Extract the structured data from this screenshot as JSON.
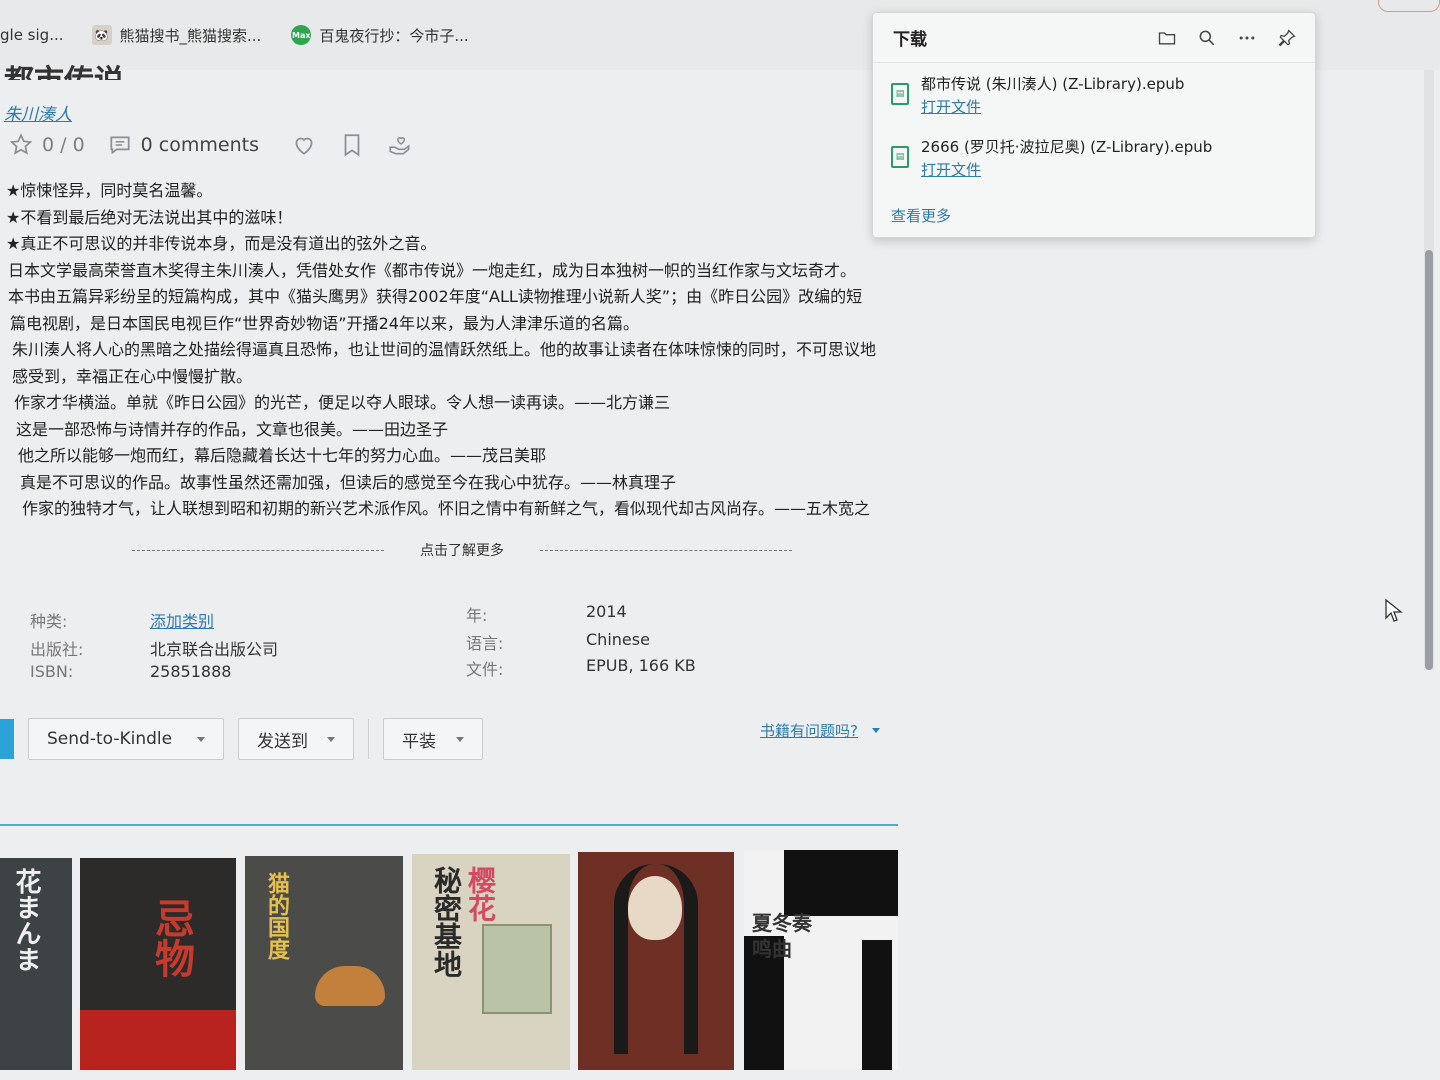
{
  "bookmarks": [
    {
      "label": "gle sig...",
      "icon": "none"
    },
    {
      "label": "熊猫搜书_熊猫搜索...",
      "icon": "panda-icon"
    },
    {
      "label": "百鬼夜行抄：今市子...",
      "icon": "max-icon",
      "badge": "Max"
    }
  ],
  "book": {
    "title": "都市传说",
    "author": "朱川湊人",
    "rating": "0 / 0",
    "comments": "0 comments"
  },
  "description": [
    "★惊悚怪异，同时莫名温馨。",
    "★不看到最后绝对无法说出其中的滋味！",
    "★真正不可思议的并非传说本身，而是没有道出的弦外之音。",
    "日本文学最高荣誉直木奖得主朱川湊人，凭借处女作《都市传说》一炮走红，成为日本独树一帜的当红作家与文坛奇才。",
    "本书由五篇异彩纷呈的短篇构成，其中《猫头鹰男》获得2002年度“ALL读物推理小说新人奖”；由《昨日公园》改编的短",
    "篇电视剧，是日本国民电视巨作“世界奇妙物语”开播24年以来，最为人津津乐道的名篇。",
    "朱川湊人将人心的黑暗之处描绘得逼真且恐怖，也让世间的温情跃然纸上。他的故事让读者在体味惊悚的同时，不可思议地",
    "感受到，幸福正在心中慢慢扩散。",
    "作家才华横溢。单就《昨日公园》的光芒，便足以夺人眼球。令人想一读再读。——北方谦三",
    "这是一部恐怖与诗情并存的作品，文章也很美。——田边圣子",
    "他之所以能够一炮而红，幕后隐藏着长达十七年的努力心血。——茂吕美耶",
    "真是不可思议的作品。故事性虽然还需加强，但读后的感觉至今在我心中犹存。——林真理子",
    "作家的独特才气，让人联想到昭和初期的新兴艺术派作风。怀旧之情中有新鲜之气，看似现代却古风尚存。——五木宽之"
  ],
  "more_link": "点击了解更多",
  "meta": {
    "category_label": "种类:",
    "category_value": "添加类别",
    "publisher_label": "出版社:",
    "publisher_value": "北京联合出版公司",
    "isbn_label": "ISBN:",
    "isbn_value": "25851888",
    "year_label": "年:",
    "year_value": "2014",
    "language_label": "语言:",
    "language_value": "Chinese",
    "file_label": "文件:",
    "file_value": "EPUB, 166 KB"
  },
  "buttons": {
    "kindle": "Send-to-Kindle",
    "send_to": "发送到",
    "format": "平装",
    "problem": "书籍有问题吗?"
  },
  "covers": [
    {
      "title": "花まんま",
      "bg": "#3d4245"
    },
    {
      "title": "忌物",
      "bg": "#2c2b2a"
    },
    {
      "title": "猫的国度",
      "bg": "#4b4b4a"
    },
    {
      "title": "秘密基地",
      "bg": "#d9d3c2",
      "subtitle": "樱花"
    },
    {
      "title": "",
      "bg": "#6e2f25"
    },
    {
      "title": "夏冬奏鸣曲",
      "bg": "#f2f2f2"
    }
  ],
  "downloads": {
    "title": "下载",
    "items": [
      {
        "name": "都市传说 (朱川湊人) (Z-Library).epub",
        "action": "打开文件"
      },
      {
        "name": "2666 (罗贝托·波拉尼奥) (Z-Library).epub",
        "action": "打开文件"
      }
    ],
    "see_more": "查看更多"
  },
  "colors": {
    "link": "#2e7bb0",
    "accent": "#2ba3d8",
    "file_icon": "#2a9b6a"
  }
}
